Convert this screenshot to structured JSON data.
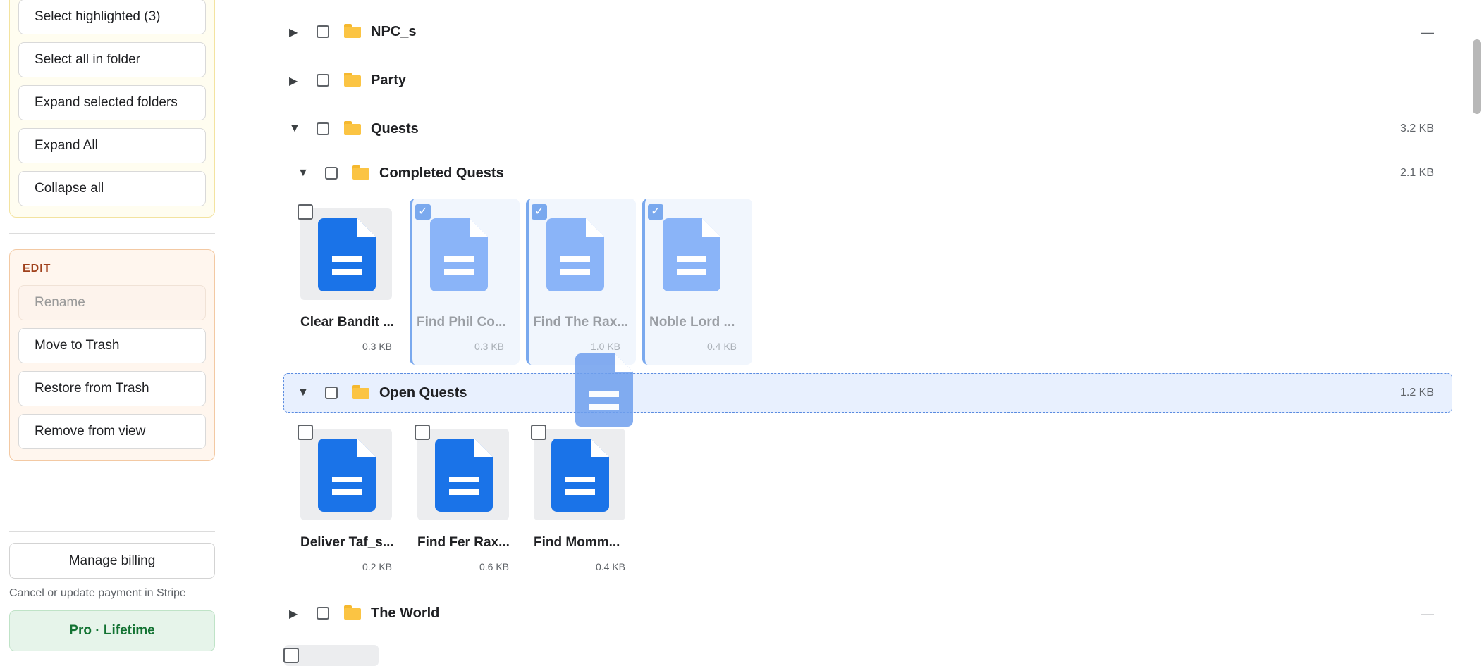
{
  "sidebar": {
    "select_buttons": [
      {
        "label": "Select highlighted (3)"
      },
      {
        "label": "Select all in folder"
      },
      {
        "label": "Expand selected folders"
      },
      {
        "label": "Expand All"
      },
      {
        "label": "Collapse all"
      }
    ],
    "edit": {
      "title": "EDIT",
      "buttons": [
        {
          "label": "Rename",
          "disabled": true
        },
        {
          "label": "Move to Trash"
        },
        {
          "label": "Restore from Trash"
        },
        {
          "label": "Remove from view"
        }
      ]
    },
    "billing": {
      "button_label": "Manage billing",
      "note": "Cancel or update payment in Stripe",
      "plan": "Pro · Lifetime"
    }
  },
  "tree": {
    "folders": {
      "npc": {
        "name": "NPC_s",
        "size": "—"
      },
      "party": {
        "name": "Party",
        "size": ""
      },
      "quests": {
        "name": "Quests",
        "size": "3.2 KB"
      },
      "completed": {
        "name": "Completed Quests",
        "size": "2.1 KB"
      },
      "open": {
        "name": "Open Quests",
        "size": "1.2 KB"
      },
      "world": {
        "name": "The World",
        "size": "—"
      }
    },
    "completed_files": [
      {
        "name": "Clear Bandit ...",
        "size": "0.3 KB",
        "selected": false
      },
      {
        "name": "Find Phil Co...",
        "size": "0.3 KB",
        "selected": true
      },
      {
        "name": "Find The Rax...",
        "size": "1.0 KB",
        "selected": true
      },
      {
        "name": "Noble Lord ...",
        "size": "0.4 KB",
        "selected": true
      }
    ],
    "open_files": [
      {
        "name": "Deliver Taf_s...",
        "size": "0.2 KB"
      },
      {
        "name": "Find Fer Rax...",
        "size": "0.6 KB"
      },
      {
        "name": "Find Momm...",
        "size": "0.4 KB"
      }
    ]
  },
  "icons": {
    "expand": "triangle-right-icon",
    "collapse": "triangle-down-icon",
    "folder": "folder-icon",
    "document": "document-icon",
    "check": "✓"
  },
  "colors": {
    "doc_blue": "#1a73e8",
    "doc_selected": "#8ab4f8",
    "folder_yellow": "#fbc443",
    "drop_target_bg": "#e8f0fe"
  }
}
